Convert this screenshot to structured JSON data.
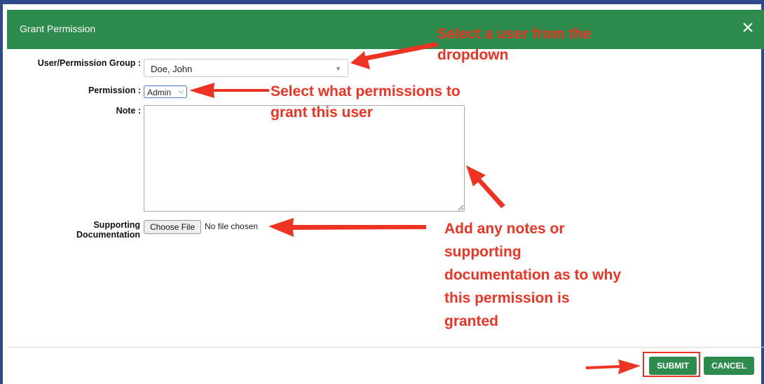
{
  "dialog": {
    "title": "Grant Permission",
    "close_icon": "×"
  },
  "form": {
    "user_group_label": "User/Permission Group :",
    "user_group_value": "Doe, John",
    "permission_label": "Permission :",
    "permission_value": "Admin",
    "note_label": "Note :",
    "note_value": "",
    "supporting_label_line1": "Supporting",
    "supporting_label_line2": "Documentation",
    "choose_file_label": "Choose File",
    "file_status": "No file chosen"
  },
  "buttons": {
    "submit": "SUBMIT",
    "cancel": "CANCEL"
  },
  "annotations": {
    "select_user": [
      "Select a user from the",
      "dropdown"
    ],
    "select_permission": [
      "Select what permissions to",
      "grant this user"
    ],
    "add_notes": [
      "Add any notes or",
      "supporting",
      "documentation as to why",
      "this permission is",
      "granted"
    ]
  },
  "colors": {
    "header_green": "#2e8b4e",
    "annotation_red": "#ee3322",
    "frame_blue": "#2f4a8a"
  }
}
